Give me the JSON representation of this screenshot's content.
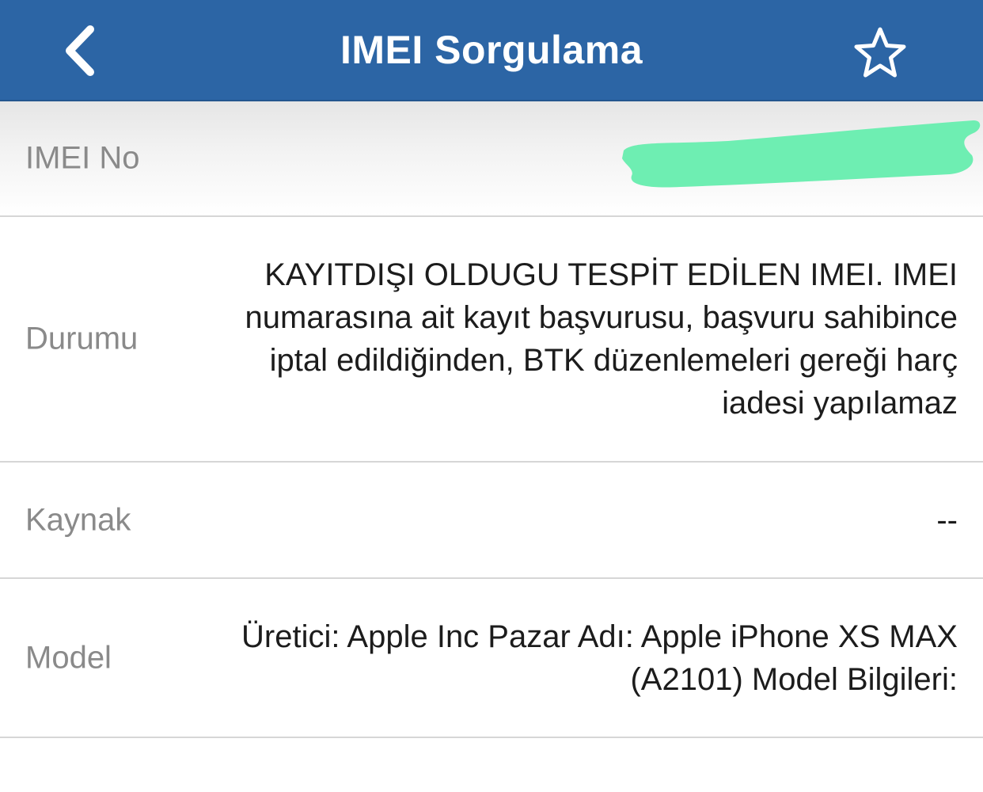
{
  "header": {
    "title": "IMEI Sorgulama",
    "back_icon": "chevron-left-icon",
    "favorite_icon": "star-outline-icon",
    "background_color": "#2c65a5"
  },
  "rows": {
    "imei": {
      "label": "IMEI No",
      "redaction_color": "#6eeeb2"
    },
    "durum": {
      "label": "Durumu",
      "value": "KAYITDIŞI OLDUGU TESPİT EDİLEN IMEI. IMEI numarasına ait kayıt başvurusu, başvuru sahibince iptal edildiğinden, BTK düzenlemeleri gereği harç iadesi yapılamaz"
    },
    "kaynak": {
      "label": "Kaynak",
      "value": "--"
    },
    "model": {
      "label": "Model",
      "value": "Üretici: Apple Inc Pazar Adı: Apple iPhone XS MAX (A2101) Model Bilgileri:"
    }
  }
}
